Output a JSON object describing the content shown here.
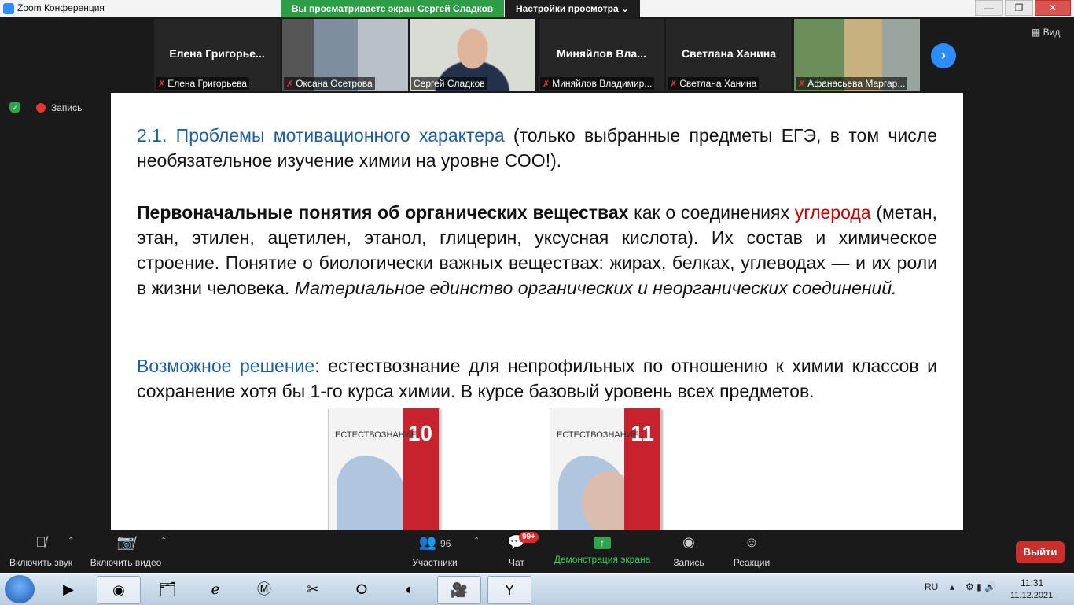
{
  "window": {
    "title": "Zoom Конференция",
    "share_banner": "Вы просматриваете экран Сергей Сладков",
    "view_settings": "Настройки просмотра ⌄",
    "minimize": "—",
    "maximize": "❐",
    "close": "✕"
  },
  "participants_strip": [
    {
      "center": "Елена  Григорье...",
      "label": "Елена Григорьева",
      "muted": true
    },
    {
      "center": "",
      "label": "Оксана Осетрова",
      "muted": true
    },
    {
      "center": "",
      "label": "Сергей Сладков",
      "muted": false
    },
    {
      "center": "Миняйлов  Вла...",
      "label": "Миняйлов Владимир...",
      "muted": true
    },
    {
      "center": "Светлана Ханина",
      "label": "Светлана Ханина",
      "muted": true
    },
    {
      "center": "",
      "label": "Афанасьева Маргар...",
      "muted": true
    }
  ],
  "view_button": "Вид",
  "next_icon": "›",
  "recording": {
    "label": "Запись"
  },
  "slide": {
    "p1_blue": "2.1. Проблемы мотивационного характера",
    "p1_rest": " (только выбранные предметы ЕГЭ, в том числе необязательное изучение химии на уровне СОО!).",
    "p2_bold": "Первоначальные понятия об органических веществах",
    "p2_mid": " как о соединениях ",
    "p2_red": "углерода",
    "p2_rest": " (метан, этан, этилен, ацетилен, этанол, глицерин, уксусная кислота). Их состав и химическое строение. Понятие о биологически важных веществах: жирах, белках, углеводах — и их роли в жизни человека. ",
    "p2_italic": "Материальное единство органических и неорганических соединений.",
    "p3_blue": "Возможное решение",
    "p3_rest": ": естествознание для непрофильных по отношению к химии классов и сохранение хотя бы 1-го курса химии. В курсе базовый уровень всех предметов.",
    "books": [
      {
        "title": "ЕСТЕСТВОЗНАНИЕ",
        "grade": "10"
      },
      {
        "title": "ЕСТЕСТВОЗНАНИЕ",
        "grade": "11"
      }
    ]
  },
  "controls": {
    "audio": "Включить звук",
    "video": "Включить видео",
    "participants": "Участники",
    "participants_count": "96",
    "chat": "Чат",
    "chat_badge": "99+",
    "share": "Демонстрация экрана",
    "record": "Запись",
    "reactions": "Реакции",
    "exit": "Выйти"
  },
  "taskbar": {
    "lang": "RU",
    "time": "11:31",
    "date": "11.12.2021"
  }
}
